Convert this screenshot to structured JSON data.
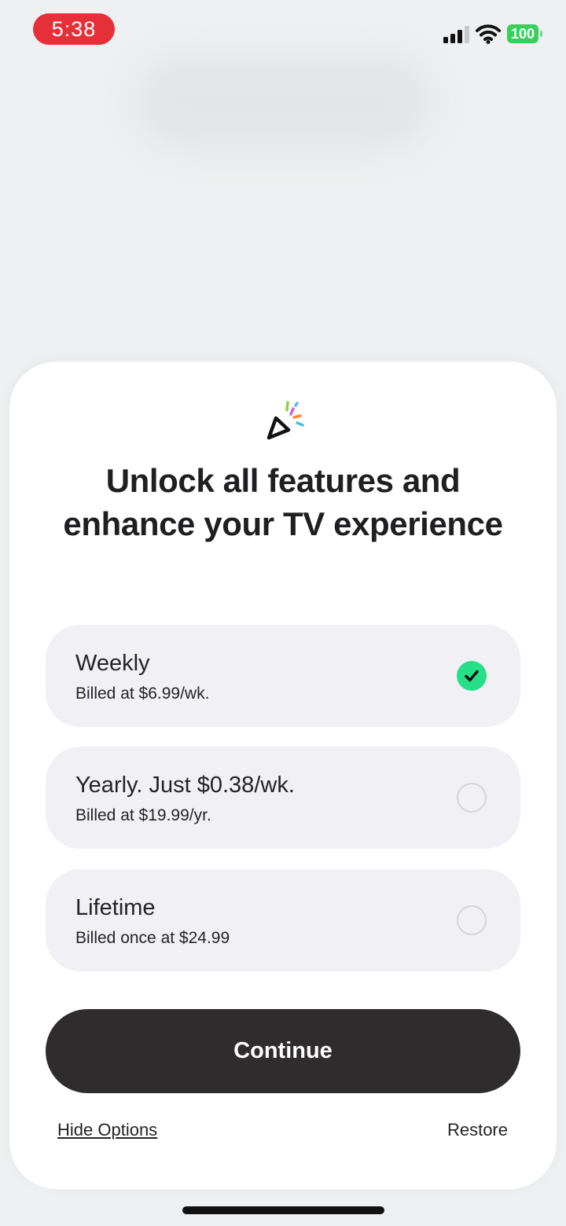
{
  "status_bar": {
    "time": "5:38",
    "battery_level": "100",
    "signal_bars": 3,
    "signal_bars_max": 4,
    "time_pill_color": "#e5303a",
    "battery_color": "#36d15a"
  },
  "paywall": {
    "logo_icon": "play-confetti-icon",
    "headline": "Unlock all features and enhance your TV experience",
    "selected_plan": "weekly",
    "selected_color": "#26e089",
    "plans": [
      {
        "id": "weekly",
        "title": "Weekly",
        "subtitle": "Billed at $6.99/wk.",
        "selected": true
      },
      {
        "id": "yearly",
        "title": "Yearly. Just $0.38/wk.",
        "subtitle": "Billed at $19.99/yr.",
        "selected": false
      },
      {
        "id": "lifetime",
        "title": "Lifetime",
        "subtitle": "Billed once at $24.99",
        "selected": false
      }
    ],
    "continue_label": "Continue",
    "hide_options_label": "Hide Options",
    "restore_label": "Restore"
  }
}
